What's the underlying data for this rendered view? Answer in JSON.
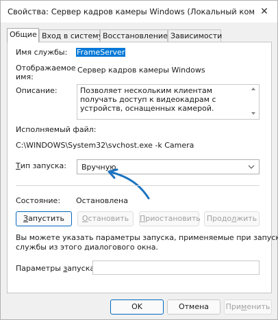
{
  "window": {
    "title": "Свойства: Сервер кадров камеры Windows (Локальный компью...",
    "close_glyph": "✕"
  },
  "tabs": [
    {
      "label": "Общие",
      "active": true
    },
    {
      "label": "Вход в систему",
      "active": false
    },
    {
      "label": "Восстановление",
      "active": false
    },
    {
      "label": "Зависимости",
      "active": false
    }
  ],
  "general": {
    "service_name_label": "Имя службы:",
    "service_name_value": "FrameServer",
    "display_name_label_1": "Отображаемое",
    "display_name_label_2": "имя:",
    "display_name_value": "Сервер кадров камеры Windows",
    "description_label": "Описание:",
    "description_value": "Позволяет нескольким клиентам получать доступ к видеокадрам с устройств, оснащенных камерой.",
    "exe_label": "Исполняемый файл:",
    "exe_path": "C:\\WINDOWS\\System32\\svchost.exe -k Camera",
    "startup_type_label_prefix": "Т",
    "startup_type_label_rest": "ип запуска:",
    "startup_type_value": "Вручную",
    "status_label": "Состояние:",
    "status_value": "Остановлена",
    "hint_line_1": "Вы можете указать параметры запуска, применяемые при запуске",
    "hint_line_2": "службы из этого диалогового окна.",
    "start_params_label_prefix": "Параметры ",
    "start_params_label_accel": "з",
    "start_params_label_rest": "апуска:",
    "start_params_value": ""
  },
  "service_buttons": {
    "start": {
      "prefix": "",
      "accel": "З",
      "rest": "апустить"
    },
    "stop": {
      "prefix": "",
      "accel": "О",
      "rest": "становить"
    },
    "pause": {
      "prefix": "",
      "accel": "П",
      "rest": "риостановить"
    },
    "resume": {
      "prefix": "Продо",
      "accel": "л",
      "rest": "жить"
    }
  },
  "footer_buttons": {
    "ok": "OK",
    "cancel": "Отмена",
    "apply_prefix": "При",
    "apply_accel": "м",
    "apply_rest": "енить"
  },
  "colors": {
    "accent": "#0078d7",
    "arrow": "#1a73c0"
  }
}
